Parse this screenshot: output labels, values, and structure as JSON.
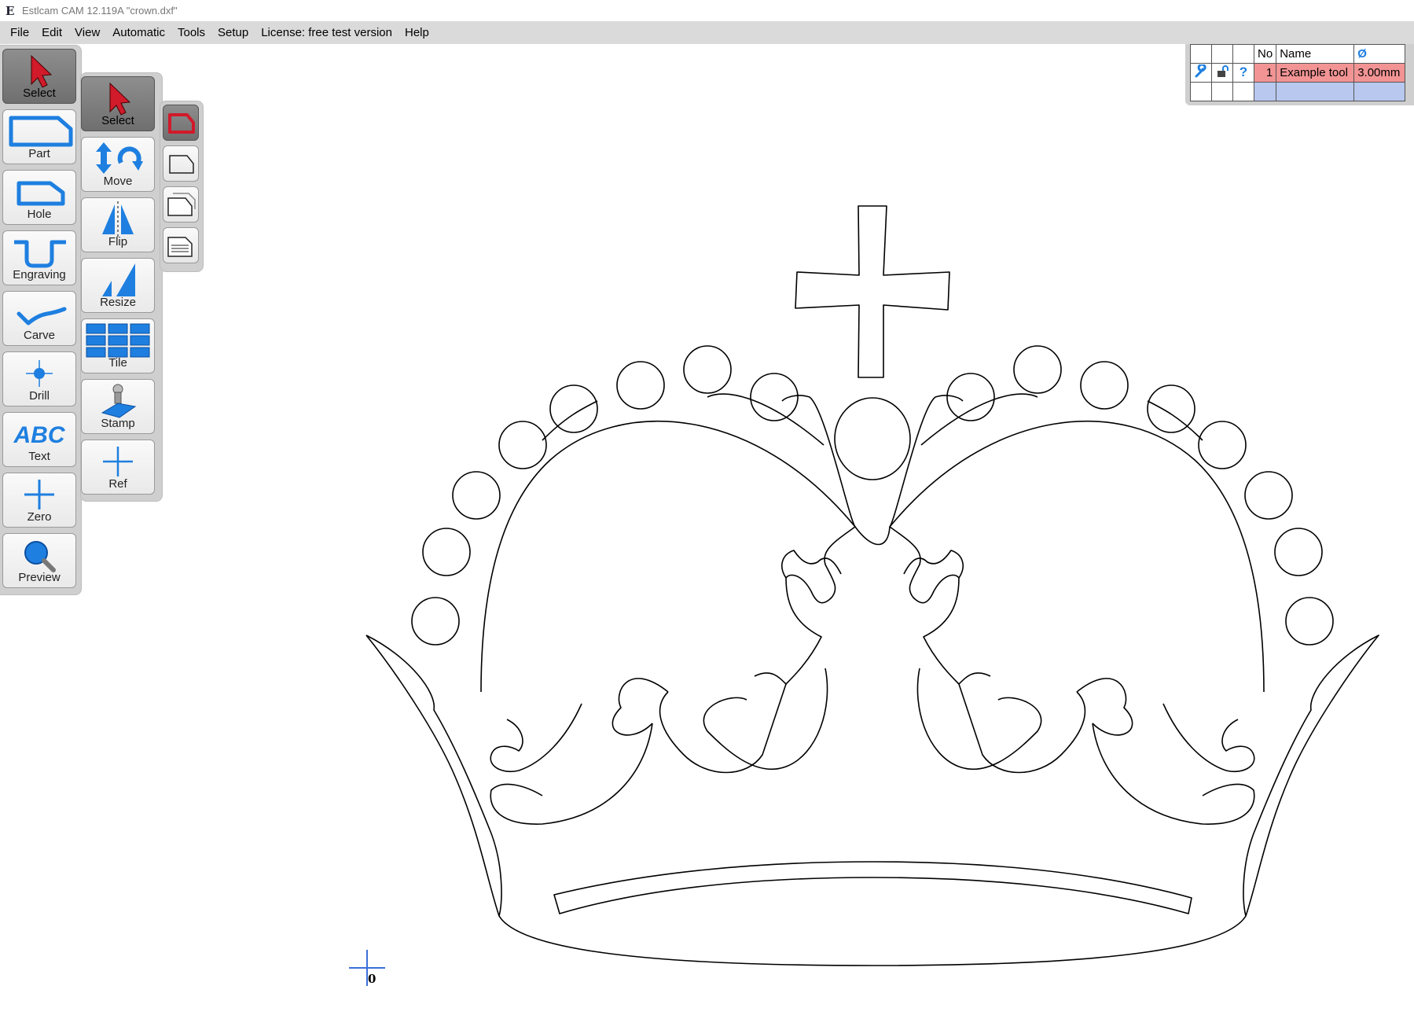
{
  "window": {
    "title": "Estlcam CAM 12.119A \"crown.dxf\"",
    "app_icon": "estlcam-logo-icon"
  },
  "menu": [
    "File",
    "Edit",
    "View",
    "Automatic",
    "Tools",
    "Setup",
    "License: free test version",
    "Help"
  ],
  "main_toolbar": [
    {
      "label": "Select",
      "icon": "cursor-arrow-icon",
      "active": true
    },
    {
      "label": "Part",
      "icon": "part-outline-icon"
    },
    {
      "label": "Hole",
      "icon": "hole-outline-icon"
    },
    {
      "label": "Engraving",
      "icon": "engraving-icon"
    },
    {
      "label": "Carve",
      "icon": "carve-icon"
    },
    {
      "label": "Drill",
      "icon": "drill-icon"
    },
    {
      "label": "Text",
      "icon": "text-abc-icon",
      "glyph": "ABC"
    },
    {
      "label": "Zero",
      "icon": "zero-cross-icon"
    },
    {
      "label": "Preview",
      "icon": "magnifier-icon"
    }
  ],
  "select_toolbar": [
    {
      "label": "Select",
      "icon": "cursor-arrow-icon",
      "active": true
    },
    {
      "label": "Move",
      "icon": "move-rotate-icon"
    },
    {
      "label": "Flip",
      "icon": "flip-icon"
    },
    {
      "label": "Resize",
      "icon": "resize-icon"
    },
    {
      "label": "Tile",
      "icon": "tile-grid-icon"
    },
    {
      "label": "Stamp",
      "icon": "stamp-icon"
    },
    {
      "label": "Ref",
      "icon": "reference-cross-icon"
    }
  ],
  "selection_modes": [
    {
      "icon": "select-single-icon",
      "active": true
    },
    {
      "icon": "select-outline-icon"
    },
    {
      "icon": "select-stacked-icon"
    },
    {
      "icon": "select-layers-icon"
    }
  ],
  "tool_table": {
    "headers": [
      "No",
      "Name",
      "Ø"
    ],
    "row_icons": [
      "wrench-icon",
      "lock-icon",
      "question-icon"
    ],
    "rows": [
      {
        "no": "1",
        "name": "Example tool",
        "diameter": "3.00mm",
        "color": "#f29494"
      },
      {
        "no": "",
        "name": "",
        "diameter": "",
        "color": "#b8c8ef"
      }
    ]
  },
  "drawing": {
    "file": "crown.dxf",
    "origin_label": "0"
  },
  "colors": {
    "accent_blue": "#1e7fe0",
    "select_red": "#d11a2a",
    "menubar": "#dadada",
    "toolbar": "#cfcfcf"
  }
}
